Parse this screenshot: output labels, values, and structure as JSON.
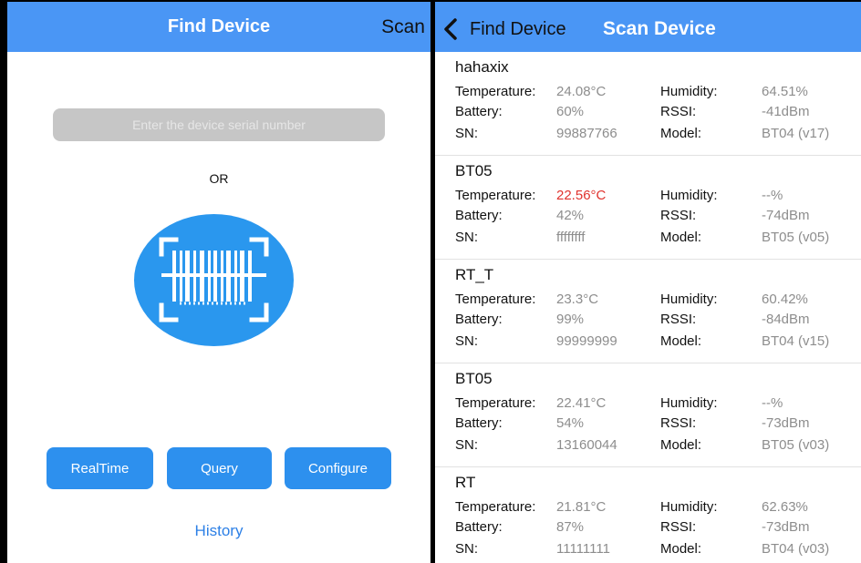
{
  "left": {
    "nav_title": "Find Device",
    "scan_label": "Scan",
    "serial_placeholder": "Enter the device serial number",
    "or_text": "OR",
    "buttons": {
      "realtime": "RealTime",
      "query": "Query",
      "configure": "Configure"
    },
    "history": "History",
    "colors": {
      "nav": "#4a96f5",
      "button": "#2d90ee",
      "scan_circle": "#2a97ee",
      "link": "#2d80e6"
    },
    "icons": {
      "scan": "barcode-scan-icon"
    }
  },
  "right": {
    "back_label": "Find Device",
    "title": "Scan Device",
    "icons": {
      "back": "chevron-left-icon"
    },
    "labels": {
      "temperature": "Temperature:",
      "humidity": "Humidity:",
      "battery": "Battery:",
      "rssi": "RSSI:",
      "sn": "SN:",
      "model": "Model:"
    },
    "highlight_color": "#e0332e",
    "devices": [
      {
        "name": "hahaxix",
        "temperature": "24.08°C",
        "humidity": "64.51%",
        "battery": "60%",
        "rssi": "-41dBm",
        "sn": "99887766",
        "model": "BT04 (v17)",
        "temp_alert": false
      },
      {
        "name": "BT05",
        "temperature": "22.56°C",
        "humidity": "--%",
        "battery": "42%",
        "rssi": "-74dBm",
        "sn": "ffffffff",
        "model": "BT05 (v05)",
        "temp_alert": true
      },
      {
        "name": "RT_T",
        "temperature": "23.3°C",
        "humidity": "60.42%",
        "battery": "99%",
        "rssi": "-84dBm",
        "sn": "99999999",
        "model": "BT04 (v15)",
        "temp_alert": false
      },
      {
        "name": "BT05",
        "temperature": "22.41°C",
        "humidity": "--%",
        "battery": "54%",
        "rssi": "-73dBm",
        "sn": "13160044",
        "model": "BT05 (v03)",
        "temp_alert": false
      },
      {
        "name": "RT",
        "temperature": "21.81°C",
        "humidity": "62.63%",
        "battery": "87%",
        "rssi": "-73dBm",
        "sn": "11111111",
        "model": "BT04 (v03)",
        "temp_alert": false
      }
    ]
  }
}
